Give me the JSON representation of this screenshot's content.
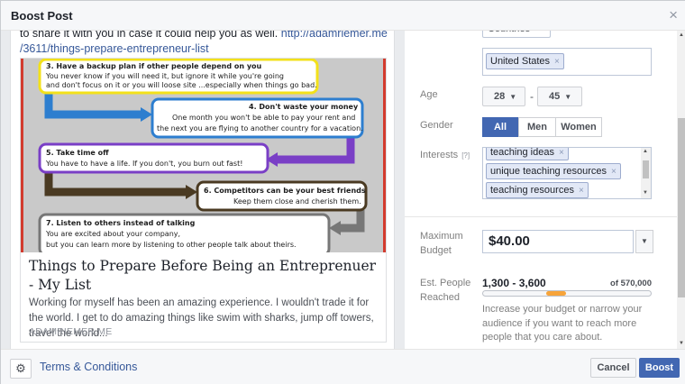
{
  "dialog": {
    "title": "Boost Post",
    "close_glyph": "×"
  },
  "post": {
    "text_top": "to share it with you in case it could help you as well.",
    "link_top": "http://adamriemer.me",
    "link_second_line": "/3611/things-prepare-entrepreneur-list"
  },
  "infographic": {
    "items": [
      {
        "heading": "3.    Have a backup plan if other people depend on you",
        "line1": "You never know if you will need it, but ignore it while you're going",
        "line2": "and don't focus on it or you will loose site ...especially when things go bad."
      },
      {
        "heading": "4.    Don't waste your money",
        "line1": "One month you won't be able to pay your rent and",
        "line2": "the next you are flying to another country for a vacation."
      },
      {
        "heading": "5.    Take time off",
        "line1": "You have to have a life.  If you don't, you burn out fast!",
        "line2": ""
      },
      {
        "heading": "6.    Competitors can be your best friends",
        "line1": "Keep them close and cherish them.",
        "line2": ""
      },
      {
        "heading": "7.    Listen to others instead of talking",
        "line1": "You are excited about your company,",
        "line2": "but you can learn more by listening to other people talk about theirs."
      }
    ]
  },
  "link_card": {
    "title": "Things to Prepare Before Being an Entreprenuer - My List",
    "description": "Working for myself has been an amazing experience. I wouldn't trade it for the world. I get to do amazing things like swim with sharks, jump off towers, travel the world...",
    "domain": "ADAMRIEMER.ME"
  },
  "targeting": {
    "country_dropdown": "Countries",
    "locations": [
      {
        "label": "United States",
        "remove": "×"
      }
    ],
    "age": {
      "label": "Age",
      "min": "28",
      "max": "45",
      "separator": "-"
    },
    "gender": {
      "label": "Gender",
      "options": [
        "All",
        "Men",
        "Women"
      ],
      "selected": "All"
    },
    "interests": {
      "label": "Interests",
      "help": "[?]",
      "tags": [
        {
          "label": "teaching ideas",
          "remove": "×"
        },
        {
          "label": "unique teaching resources",
          "remove": "×"
        },
        {
          "label": "teaching resources",
          "remove": "×"
        }
      ]
    }
  },
  "budget": {
    "label": "Maximum Budget",
    "value": "$40.00"
  },
  "reach": {
    "label": "Est. People Reached",
    "range": "1,300 - 3,600",
    "total": "of 570,000",
    "range_low": 1300,
    "range_high": 3600,
    "range_max": 570000,
    "hint": "Increase your budget or narrow your audience if you want to reach more people that you care about."
  },
  "footer": {
    "terms": "Terms & Conditions",
    "cancel": "Cancel",
    "boost": "Boost"
  },
  "icons": {
    "gear": "gear-icon",
    "close": "close-icon",
    "caret": "caret-down-icon"
  },
  "colors": {
    "accent": "#4267b2",
    "link": "#365899",
    "reach_fill": "#f7a43a",
    "header_bg": "#f6f7f9"
  }
}
